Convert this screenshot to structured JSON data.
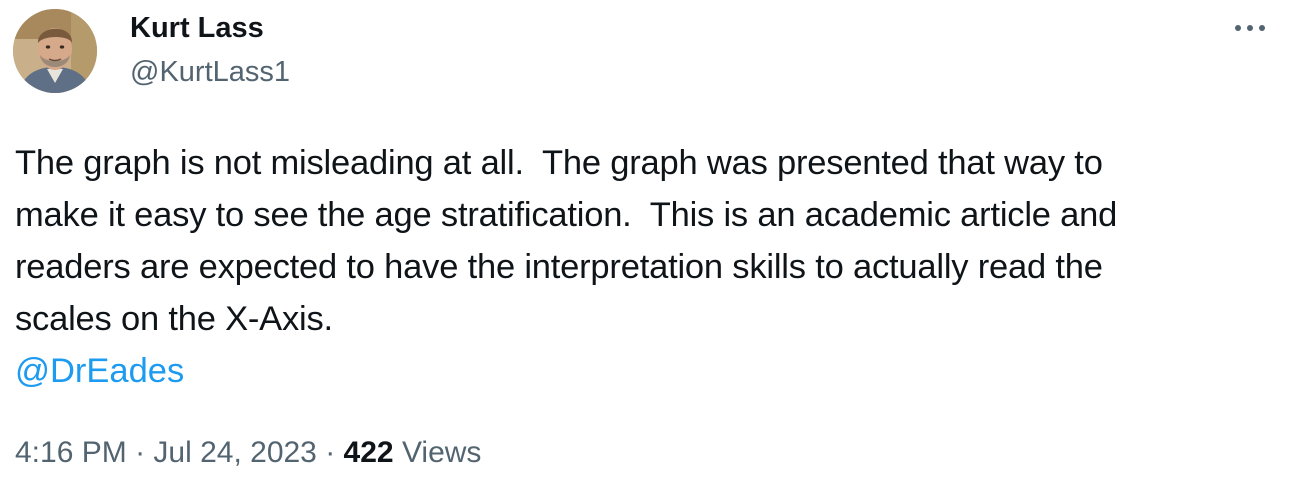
{
  "author": {
    "display_name": "Kurt Lass",
    "handle": "@KurtLass1"
  },
  "tweet": {
    "text": "The graph is not misleading at all.  The graph was presented that way to\nmake it easy to see the age stratification.  This is an academic article and\nreaders are expected to have the interpretation skills to actually read the\nscales on the X-Axis.",
    "mention": "@DrEades"
  },
  "meta": {
    "time": "4:16 PM",
    "separator": " · ",
    "date": "Jul 24, 2023",
    "views_count": "422",
    "views_label": " Views"
  },
  "icons": {
    "more": "more-options-icon",
    "avatar": "user-avatar"
  },
  "colors": {
    "text_primary": "#0f1419",
    "text_secondary": "#536471",
    "link": "#1d9bf0",
    "background": "#ffffff"
  }
}
